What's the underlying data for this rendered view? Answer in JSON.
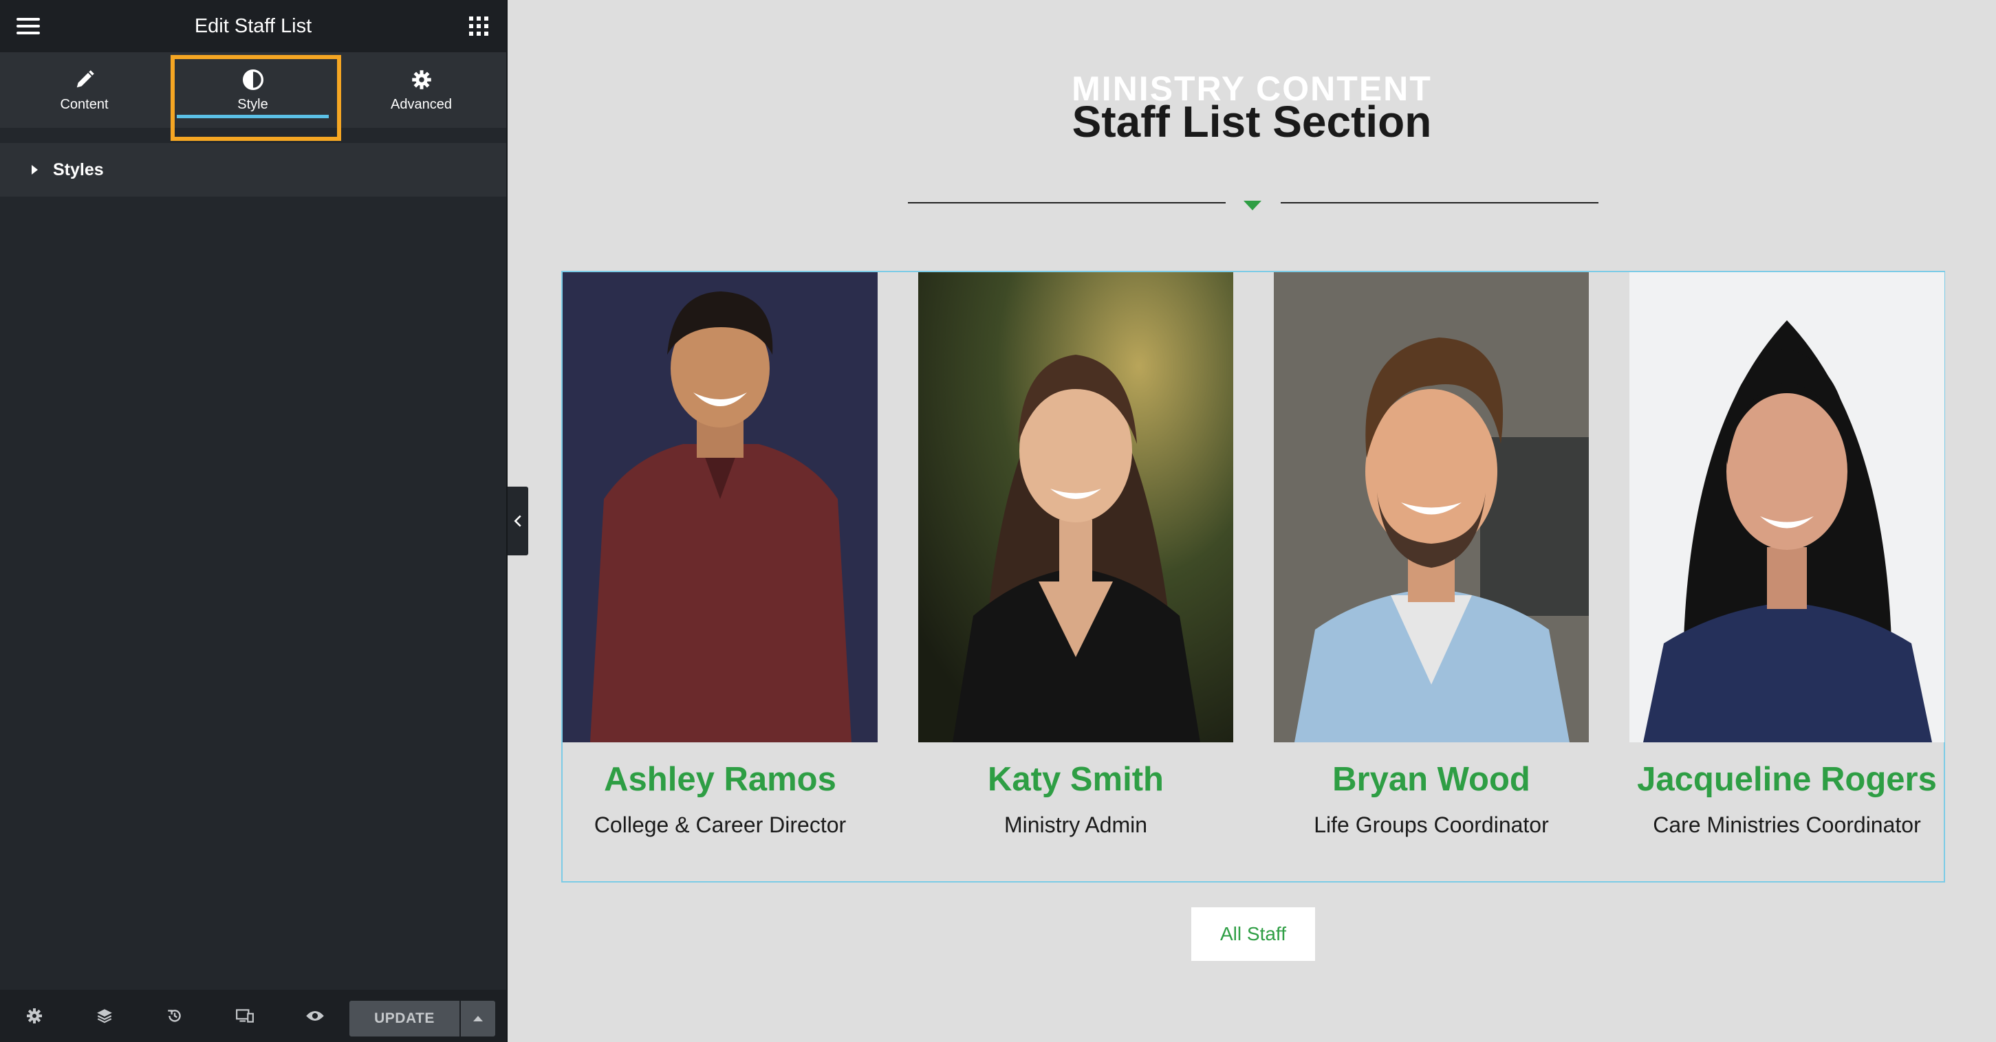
{
  "panel": {
    "title": "Edit Staff List",
    "tabs": [
      {
        "label": "Content",
        "icon": "pencil-icon"
      },
      {
        "label": "Style",
        "icon": "half-circle-icon",
        "active": true
      },
      {
        "label": "Advanced",
        "icon": "gear-icon"
      }
    ],
    "section": {
      "label": "Styles",
      "icon": "caret-right-icon"
    },
    "footer": {
      "icons": [
        "gear-icon",
        "layers-icon",
        "history-icon",
        "responsive-icon",
        "eye-icon"
      ],
      "update_label": "UPDATE"
    }
  },
  "preview": {
    "eyebrow": "MINISTRY CONTENT",
    "heading": "Staff List Section",
    "accent_color": "#2e9e44",
    "staff": [
      {
        "name": "Ashley Ramos",
        "role": "College & Career Director"
      },
      {
        "name": "Katy Smith",
        "role": "Ministry Admin"
      },
      {
        "name": "Bryan Wood",
        "role": "Life Groups Coordinator"
      },
      {
        "name": "Jacqueline Rogers",
        "role": "Care Ministries Coordinator"
      }
    ],
    "all_staff_label": "All Staff"
  }
}
